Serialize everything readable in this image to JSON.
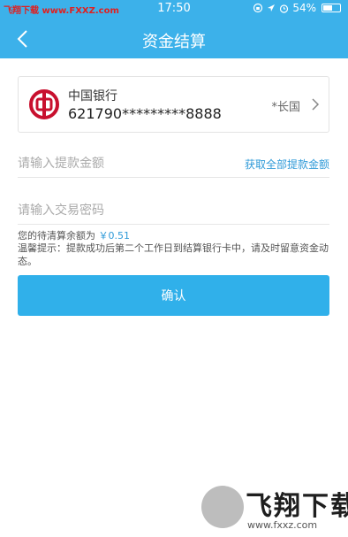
{
  "status_bar": {
    "watermark_brand": "飞翔下载",
    "watermark_site": "www.FXXZ.com",
    "time": "17:50",
    "battery": "54%"
  },
  "nav": {
    "title": "资金结算"
  },
  "bank_card": {
    "bank_name": "中国银行",
    "account": "621790*********8888",
    "holder": "*长国",
    "brand_color": "#c8102e"
  },
  "withdraw": {
    "amount_placeholder": "请输入提款金额",
    "get_all_label": "获取全部提款金额",
    "password_placeholder": "请输入交易密码"
  },
  "info": {
    "balance_label": "您的待清算余额为",
    "balance_amount": "￥0.51",
    "tip": "温馨提示：提款成功后第二个工作日到结算银行卡中，请及时留意资金动态。"
  },
  "confirm_label": "确认",
  "watermark_bottom": {
    "brand": "飞翔下载",
    "url": "www.fxxz.com"
  },
  "colors": {
    "header": "#3cb1ea",
    "accent": "#30b0ea",
    "link": "#2f9ad8"
  }
}
